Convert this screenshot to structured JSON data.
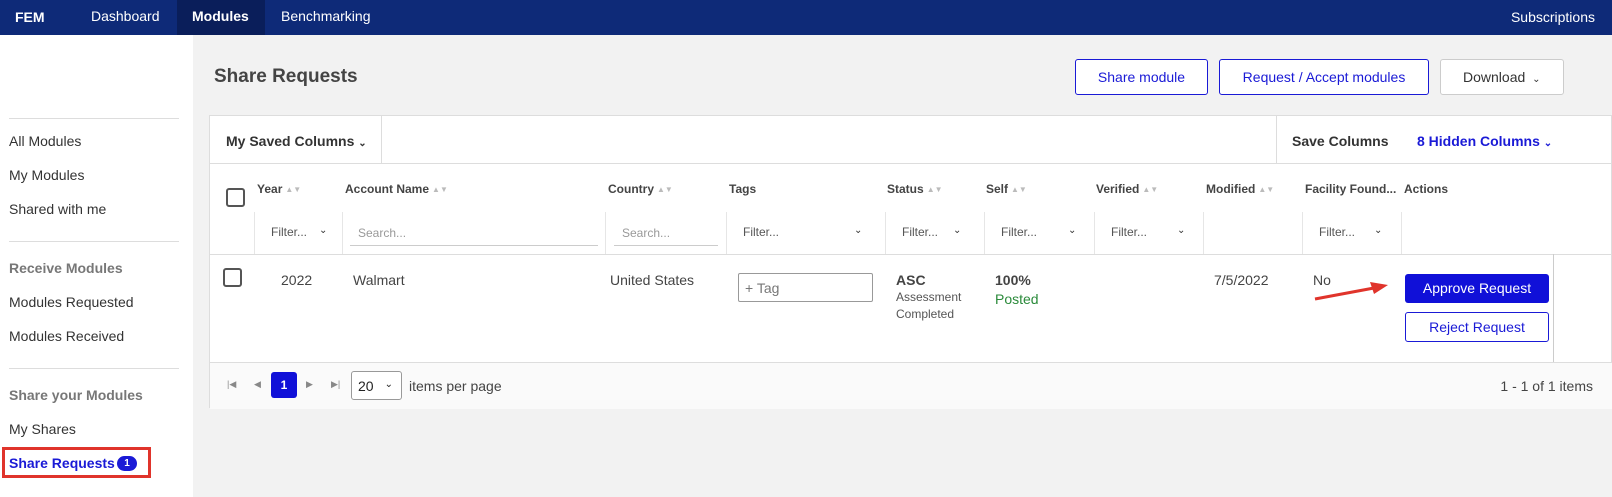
{
  "nav": {
    "brand": "FEM",
    "items": [
      {
        "label": "Dashboard"
      },
      {
        "label": "Modules"
      },
      {
        "label": "Benchmarking"
      }
    ],
    "subscriptions": "Subscriptions"
  },
  "sidebar": {
    "all_modules": "All Modules",
    "my_modules": "My Modules",
    "shared_with_me": "Shared with me",
    "receive_heading": "Receive Modules",
    "modules_requested": "Modules Requested",
    "modules_received": "Modules Received",
    "share_heading": "Share your Modules",
    "my_shares": "My Shares",
    "share_requests": "Share Requests",
    "share_requests_badge": "1"
  },
  "header": {
    "title": "Share Requests",
    "share_module": "Share module",
    "request_accept": "Request / Accept modules",
    "download": "Download"
  },
  "toolbar": {
    "saved_columns": "My Saved Columns",
    "save_columns": "Save Columns",
    "hidden_columns": "8 Hidden Columns"
  },
  "columns": {
    "year": "Year",
    "account": "Account Name",
    "country": "Country",
    "tags": "Tags",
    "status": "Status",
    "self": "Self",
    "verified": "Verified",
    "modified": "Modified",
    "facility": "Facility Found...",
    "actions": "Actions"
  },
  "filters": {
    "filter_placeholder": "Filter...",
    "search_placeholder": "Search..."
  },
  "row": {
    "year": "2022",
    "account": "Walmart",
    "country": "United States",
    "tag_placeholder": "+ Tag",
    "status_code": "ASC",
    "status_desc": "Assessment Completed",
    "self_pct": "100%",
    "self_state": "Posted",
    "modified": "7/5/2022",
    "facility": "No",
    "approve": "Approve Request",
    "reject": "Reject Request"
  },
  "pager": {
    "current_page": "1",
    "page_size": "20",
    "items_per_page": "items per page",
    "count": "1 - 1 of 1 items"
  },
  "colors": {
    "nav_bg": "#0e2a78",
    "accent": "#1a1ad6",
    "posted_green": "#2a8a3a",
    "highlight_red": "#e0342b"
  }
}
